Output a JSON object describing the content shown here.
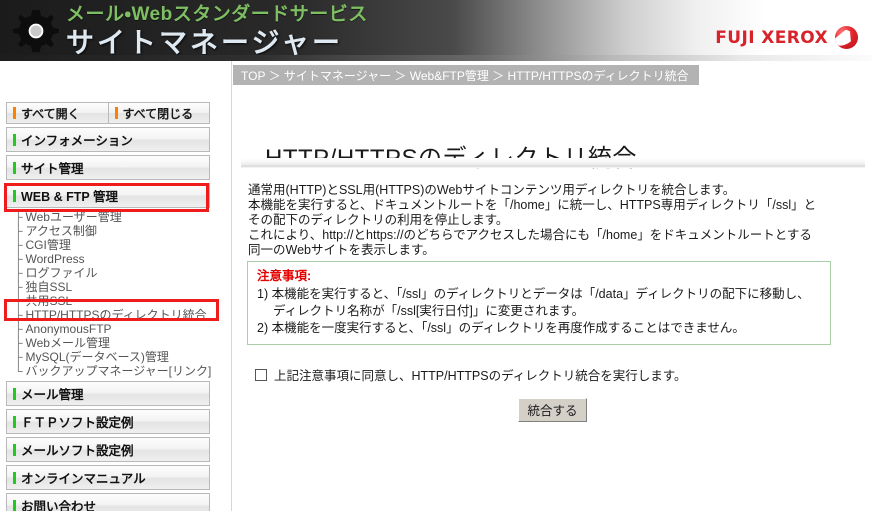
{
  "header": {
    "brand_sub": "メール・Webスタンダードサービス",
    "brand_main": "サイトマネージャー",
    "corp_logo_text": "FUJI XEROX",
    "gear_icon": "gear-icon",
    "ball_icon": "xerox-ball-icon"
  },
  "breadcrumb": {
    "text": "TOP ＞ サイトマネージャー ＞ Web&FTP管理 ＞ HTTP/HTTPSのディレクトリ統合"
  },
  "sidebar": {
    "expand_all": "すべて開く",
    "collapse_all": "すべて閉じる",
    "sections": [
      {
        "label": "インフォメーション",
        "accent": "#1ecb1e",
        "active": false
      },
      {
        "label": "サイト管理",
        "accent": "#1ecb1e",
        "active": false
      },
      {
        "label": "WEB & FTP 管理",
        "accent": "#1ecb1e",
        "active": true
      },
      {
        "label": "メール管理",
        "accent": "#1ecb1e",
        "active": false
      },
      {
        "label": "ＦＴＰソフト設定例",
        "accent": "#1ecb1e",
        "active": false
      },
      {
        "label": "メールソフト設定例",
        "accent": "#1ecb1e",
        "active": false
      },
      {
        "label": "オンラインマニュアル",
        "accent": "#1ecb1e",
        "active": false
      },
      {
        "label": "お問い合わせ",
        "accent": "#1ecb1e",
        "active": false
      }
    ],
    "webftp_items": [
      {
        "label": "Webユーザー管理",
        "selected": false
      },
      {
        "label": "アクセス制御",
        "selected": false
      },
      {
        "label": "CGI管理",
        "selected": false
      },
      {
        "label": "WordPress",
        "selected": false
      },
      {
        "label": "ログファイル",
        "selected": false
      },
      {
        "label": "独自SSL",
        "selected": false
      },
      {
        "label": "共用SSL",
        "selected": false
      },
      {
        "label": "HTTP/HTTPSのディレクトリ統合",
        "selected": true
      },
      {
        "label": "AnonymousFTP",
        "selected": false
      },
      {
        "label": "Webメール管理",
        "selected": false
      },
      {
        "label": "MySQL(データベース)管理",
        "selected": false
      },
      {
        "label": "バックアップマネージャー[リンク]",
        "selected": false
      }
    ]
  },
  "main": {
    "title": "HTTP/HTTPSのディレクトリ統合",
    "description": [
      "通常用(HTTP)とSSL用(HTTPS)のWebサイトコンテンツ用ディレクトリを統合します。",
      "本機能を実行すると、ドキュメントルートを「/home」に統一し、HTTPS専用ディレクトリ「/ssl」と",
      "その配下のディレクトリの利用を停止します。",
      "これにより、http://とhttps://のどちらでアクセスした場合にも「/home」をドキュメントルートとする",
      "同一のWebサイトを表示します。"
    ],
    "notice": {
      "title": "注意事項:",
      "border_color": "#a8cfa8",
      "title_color": "#e60000",
      "lines": [
        {
          "text": "1) 本機能を実行すると、「/ssl」のディレクトリとデータは「/data」ディレクトリの配下に移動し、",
          "indent": false
        },
        {
          "text": "ディレクトリ名称が「/ssl[実行日付]」に変更されます。",
          "indent": true
        },
        {
          "text": "2) 本機能を一度実行すると、「/ssl」のディレクトリを再度作成することはできません。",
          "indent": false
        }
      ]
    },
    "agree": {
      "checked": false,
      "label": "上記注意事項に同意し、HTTP/HTTPSのディレクトリ統合を実行します。"
    },
    "submit_label": "統合する"
  },
  "colors": {
    "accent_green": "#1ecb1e",
    "accent_orange": "#ff8000",
    "highlight_red": "#ef1c1c",
    "breadcrumb_bg": "#b3b3b3",
    "fuji_red": "#d8232a"
  }
}
